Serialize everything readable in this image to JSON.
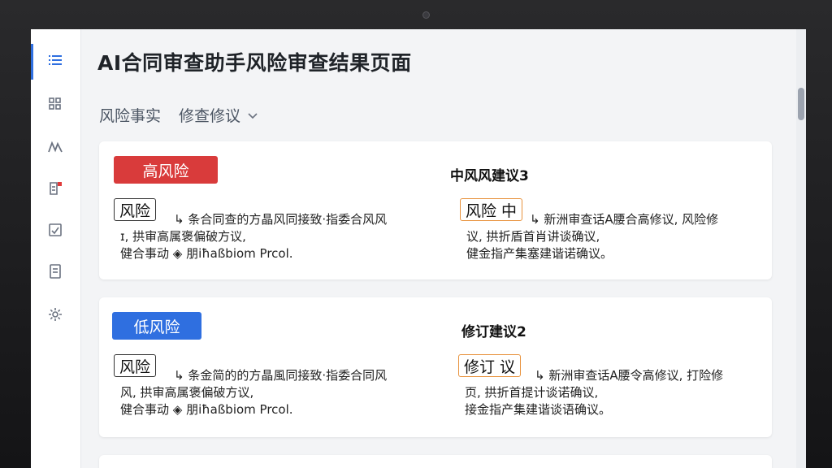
{
  "page": {
    "title": "AI合同审查助手风险审查结果页面"
  },
  "tabs": [
    {
      "label": "风险事实"
    },
    {
      "label": "修查修议"
    }
  ],
  "sidebar": {
    "items": [
      {
        "icon": "list-icon"
      },
      {
        "icon": "grid-icon"
      },
      {
        "icon": "chart-icon"
      },
      {
        "icon": "document-alert-icon"
      },
      {
        "icon": "check-square-icon"
      },
      {
        "icon": "notebook-icon"
      },
      {
        "icon": "gear-icon"
      }
    ]
  },
  "cards": [
    {
      "badge": "高风险",
      "badge_color": "#d93b3b",
      "right_title": "中风风建议3",
      "left_tag": "风险",
      "left_lines": [
        "↳ 条合同查的方晶风同接致·指委合风风",
        "ɪ, 拱审高属褒偏破方议,",
        "健合事动 ◈ 朋iħaßbiom Prcol."
      ],
      "right_tag": "风险 中",
      "right_lines": [
        "↳ 新洲审查话A腰合高修议, 风险修",
        "议, 拱折盾首肖讲谈确议,",
        "健金指产集塞建谐诺确议。"
      ]
    },
    {
      "badge": "低风险",
      "badge_color": "#2f6fe0",
      "right_title": "修订建议2",
      "left_tag": "风险",
      "left_lines": [
        "↳ 条金简的的方晶風同接致·指委合同风",
        "风, 拱审高属褒偏破方议,",
        "健合事动 ◈ 朋iħaßbiom Prcol."
      ],
      "right_tag": "修订 议",
      "right_lines": [
        "↳ 新洲审查话A腰令高修议, 打险修",
        "页, 拱折首提计谈诺确议,",
        "接金指产集建谐谈语确议。"
      ]
    }
  ]
}
